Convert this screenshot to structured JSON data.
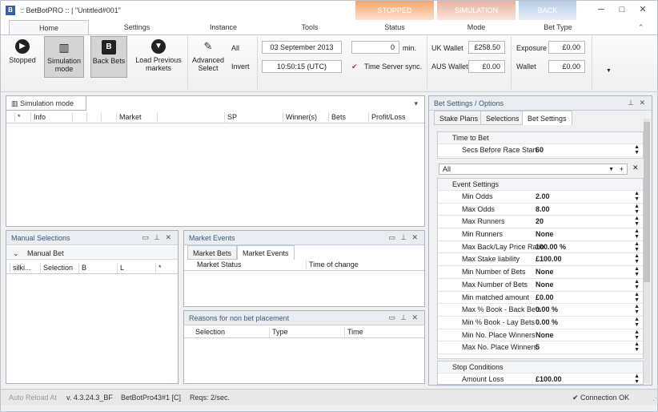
{
  "window": {
    "title": ":: BetBotPRO :: | \"Untitled#001\"",
    "app_icon": "app-logo-icon"
  },
  "context_tabs": {
    "stopped": "STOPPED",
    "simulation": "SIMULATION",
    "back": "BACK"
  },
  "ribbon_tabs": [
    "Home",
    "Settings",
    "Instance",
    "Tools",
    "Status",
    "Mode",
    "Bet Type"
  ],
  "ribbon": {
    "stopped": "Stopped",
    "simulation_mode": "Simulation mode",
    "back_bets": "Back Bets",
    "load_previous": "Load Previous markets",
    "advanced_select": "Advanced Select",
    "all": "All",
    "invert": "Invert",
    "date": "03 September 2013",
    "time": "10:50:15 (UTC)",
    "min_value": "0",
    "min_label": "min.",
    "time_server": "Time Server sync.",
    "uk_wallet_label": "UK Wallet",
    "uk_wallet": "£258.50",
    "aus_wallet_label": "AUS Wallet",
    "aus_wallet": "£0.00",
    "exposure_label": "Exposure",
    "exposure": "£0.00",
    "wallet_label": "Wallet",
    "wallet": "£0.00"
  },
  "main_panel": {
    "title": "Simulation mode",
    "columns": [
      "*",
      "Info",
      "",
      "",
      "",
      "Market",
      "",
      "SP",
      "Winner(s)",
      "Bets",
      "Profit/Loss"
    ]
  },
  "manual_selections": {
    "title": "Manual Selections",
    "group": "Manual Bet",
    "columns": [
      "silki...",
      "Selection",
      "B",
      "L",
      "*"
    ]
  },
  "market_events": {
    "title": "Market Events",
    "tabs": [
      "Market Bets",
      "Market Events"
    ],
    "columns": [
      "Market Status",
      "Time of change"
    ]
  },
  "reasons": {
    "title": "Reasons for non bet placement",
    "columns": [
      "Selection",
      "Type",
      "Time"
    ]
  },
  "bet_settings": {
    "title": "Bet Settings / Options",
    "tabs": [
      "Stake Plans",
      "Selections",
      "Bet Settings"
    ],
    "time_group": "Time to Bet",
    "secs_label": "Secs Before Race Start",
    "secs_value": "60",
    "filter": "All",
    "event_group": "Event Settings",
    "rows": [
      {
        "k": "Min Odds",
        "v": "2.00"
      },
      {
        "k": "Max Odds",
        "v": "8.00"
      },
      {
        "k": "Max Runners",
        "v": "20"
      },
      {
        "k": "Min Runners",
        "v": "None"
      },
      {
        "k": "Max Back/Lay Price Ratio",
        "v": "100.00 %"
      },
      {
        "k": "Max Stake liability",
        "v": "£100.00"
      },
      {
        "k": "Min Number of Bets",
        "v": "None"
      },
      {
        "k": "Max Number of Bets",
        "v": "None"
      },
      {
        "k": "Min matched amount",
        "v": "£0.00"
      },
      {
        "k": "Max % Book - Back Bets",
        "v": "0.00 %"
      },
      {
        "k": "Min % Book - Lay Bets",
        "v": "0.00 %"
      },
      {
        "k": "Min No. Place Winners",
        "v": "None"
      },
      {
        "k": "Max No. Place Winners",
        "v": "5"
      }
    ],
    "stop_group": "Stop Conditions",
    "amount_loss_label": "Amount Loss",
    "amount_loss": "£100.00"
  },
  "status": {
    "auto_reload": "Auto Reload At",
    "version": "v. 4.3.24.3_BF",
    "instance": "BetBotPro43#1 [C]",
    "reqs": "Reqs: 2/sec.",
    "connection": "Connection OK"
  }
}
